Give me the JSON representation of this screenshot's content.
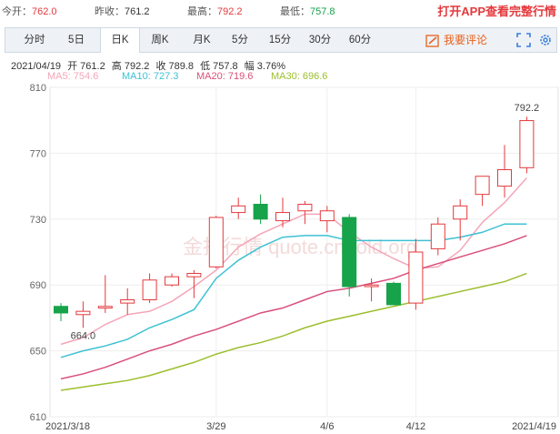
{
  "quote": {
    "open_label": "今开：",
    "open_value": "762.0",
    "prev_close_label": "昨收：",
    "prev_close_value": "761.2",
    "high_label": "最高：",
    "high_value": "792.2",
    "low_label": "最低：",
    "low_value": "757.8",
    "app_link": "打开APP查看完整行情"
  },
  "tabs": [
    {
      "label": "分时"
    },
    {
      "label": "5日"
    },
    {
      "label": "日K",
      "active": true
    },
    {
      "label": "周K"
    },
    {
      "label": "月K"
    },
    {
      "label": "5分"
    },
    {
      "label": "15分"
    },
    {
      "label": "30分"
    },
    {
      "label": "60分"
    }
  ],
  "toolbar": {
    "comment_label": "我要评论",
    "comment_icon": "edit-icon",
    "fullscreen_icon": "fullscreen-icon",
    "settings_icon": "gear-icon",
    "accent_color": "#e8601c"
  },
  "info": {
    "date": "2021/04/19",
    "open": "开 761.2",
    "high": "高 792.2",
    "close": "收 789.8",
    "low": "低 757.8",
    "amplitude": "幅 3.76%"
  },
  "ma_legend": [
    {
      "label": "MA5: 754.6",
      "color": "#f4a6b8"
    },
    {
      "label": "MA10: 727.3",
      "color": "#3ec1d3"
    },
    {
      "label": "MA20: 719.6",
      "color": "#d94f7a"
    },
    {
      "label": "MA30: 696.6",
      "color": "#9cbf2e"
    }
  ],
  "watermark": "金投行情 quote.cngold.org",
  "chart_data": {
    "type": "candlestick",
    "y_ticks": [
      "810",
      "770",
      "730",
      "690",
      "650",
      "610"
    ],
    "ylim": [
      610,
      810
    ],
    "x_ticks": [
      {
        "label": "2021/3/18",
        "index": 0
      },
      {
        "label": "3/29",
        "index": 7
      },
      {
        "label": "4/6",
        "index": 12
      },
      {
        "label": "4/12",
        "index": 16
      },
      {
        "label": "2021/4/19",
        "index": 21
      }
    ],
    "annotations": [
      {
        "text": "792.2",
        "index": 21,
        "value": 792.2,
        "pos": "above"
      },
      {
        "text": "664.0",
        "index": 1,
        "value": 664.0,
        "pos": "below"
      }
    ],
    "up_color": "#e4393c",
    "down_color": "#16a34a",
    "candles": [
      {
        "o": 677,
        "h": 679,
        "l": 668,
        "c": 673
      },
      {
        "o": 672,
        "h": 680,
        "l": 664,
        "c": 674
      },
      {
        "o": 676,
        "h": 696,
        "l": 673,
        "c": 677
      },
      {
        "o": 679,
        "h": 688,
        "l": 672,
        "c": 681
      },
      {
        "o": 681,
        "h": 697,
        "l": 679,
        "c": 693
      },
      {
        "o": 690,
        "h": 697,
        "l": 689,
        "c": 695
      },
      {
        "o": 695,
        "h": 699,
        "l": 682,
        "c": 697
      },
      {
        "o": 701,
        "h": 732,
        "l": 700,
        "c": 731
      },
      {
        "o": 734,
        "h": 743,
        "l": 730,
        "c": 738
      },
      {
        "o": 739,
        "h": 745,
        "l": 727,
        "c": 730
      },
      {
        "o": 729,
        "h": 743,
        "l": 725,
        "c": 734
      },
      {
        "o": 735,
        "h": 741,
        "l": 727,
        "c": 739
      },
      {
        "o": 729,
        "h": 738,
        "l": 722,
        "c": 735
      },
      {
        "o": 731,
        "h": 733,
        "l": 683,
        "c": 689
      },
      {
        "o": 689,
        "h": 694,
        "l": 680,
        "c": 690
      },
      {
        "o": 691,
        "h": 692,
        "l": 678,
        "c": 678
      },
      {
        "o": 679,
        "h": 718,
        "l": 675,
        "c": 710
      },
      {
        "o": 712,
        "h": 731,
        "l": 708,
        "c": 727
      },
      {
        "o": 730,
        "h": 742,
        "l": 717,
        "c": 738
      },
      {
        "o": 745,
        "h": 756,
        "l": 738,
        "c": 756
      },
      {
        "o": 750,
        "h": 775,
        "l": 743,
        "c": 760
      },
      {
        "o": 761.2,
        "h": 792.2,
        "l": 757.8,
        "c": 789.8
      }
    ],
    "series": [
      {
        "name": "MA5",
        "color": "#f4a6b8",
        "values": [
          654,
          658,
          666,
          672,
          674,
          680,
          689,
          699,
          713,
          721,
          727,
          733,
          733,
          722,
          713,
          706,
          700,
          701,
          711,
          728,
          740,
          755
        ]
      },
      {
        "name": "MA10",
        "color": "#3ec1d3",
        "values": [
          646,
          650,
          653,
          657,
          664,
          669,
          675,
          694,
          705,
          713,
          719,
          720,
          720,
          717,
          717,
          717,
          717,
          717,
          719,
          722,
          727,
          727
        ]
      },
      {
        "name": "MA20",
        "color": "#d94f7a",
        "values": [
          633,
          636,
          640,
          645,
          650,
          654,
          659,
          663,
          668,
          673,
          676,
          681,
          686,
          688,
          691,
          694,
          699,
          703,
          707,
          711,
          715,
          720
        ]
      },
      {
        "name": "MA30",
        "color": "#9cbf2e",
        "values": [
          626,
          628,
          630,
          632,
          635,
          639,
          643,
          648,
          652,
          655,
          659,
          664,
          668,
          671,
          674,
          677,
          680,
          683,
          686,
          689,
          692,
          697
        ]
      }
    ]
  }
}
